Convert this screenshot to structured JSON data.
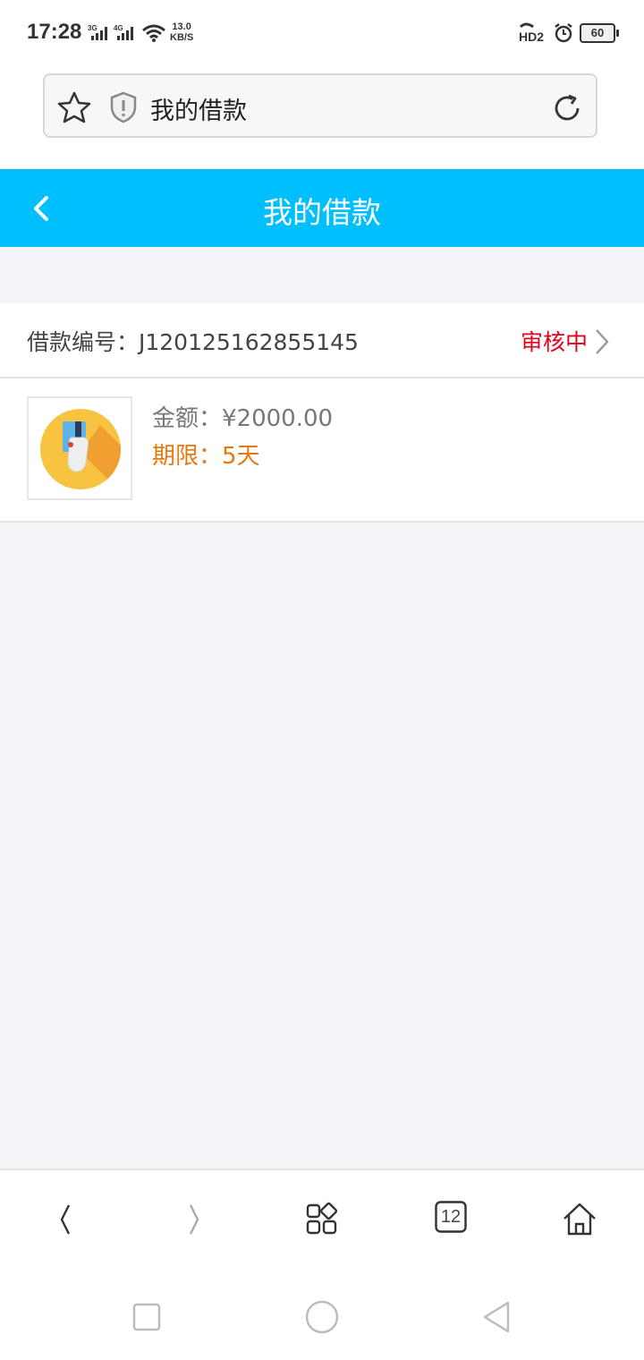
{
  "status_bar": {
    "time": "17:28",
    "net_speed_value": "13.0",
    "net_speed_unit": "KB/S",
    "signal_1": "3G",
    "signal_2": "4G",
    "hd_label": "HD2",
    "battery": "60"
  },
  "browser": {
    "address_title": "我的借款",
    "tab_count": "12"
  },
  "header": {
    "title": "我的借款"
  },
  "loan": {
    "number_label": "借款编号：J120125162855145",
    "status": "审核中",
    "amount": "金额：¥2000.00",
    "term": "期限：5天"
  },
  "colors": {
    "header_bg": "#00bfff",
    "status_red": "#e4001b",
    "term_orange": "#e9770d",
    "page_bg": "#f3f3f8"
  },
  "icons": {
    "address_left": "star-icon",
    "security": "shield-icon",
    "refresh": "refresh-icon",
    "back": "chevron-left-icon",
    "status_arrow": "chevron-right-icon",
    "toolbar": [
      "back-icon",
      "forward-icon",
      "apps-icon",
      "tabs-icon",
      "home-icon"
    ]
  }
}
